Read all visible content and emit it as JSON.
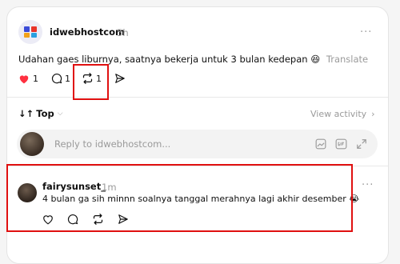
{
  "post": {
    "username": "idwebhostcom",
    "time": "5h",
    "more": "···",
    "text": "Udahan gaes liburnya, saatnya bekerja untuk 3 bulan kedepan 😆",
    "translate": "Translate",
    "likes": "1",
    "replies": "1",
    "reposts": "1"
  },
  "sort": {
    "label": "Top",
    "view_activity": "View activity"
  },
  "reply_input": {
    "placeholder": "Reply to idwebhostcom..."
  },
  "reply": {
    "username": "fairysunset_",
    "time": "1m",
    "more": "···",
    "text": "4 bulan ga sih minnn soalnya tanggal merahnya lagi akhir desember 😭"
  },
  "colors": {
    "like_red": "#ff3040",
    "highlight": "#e01010"
  }
}
